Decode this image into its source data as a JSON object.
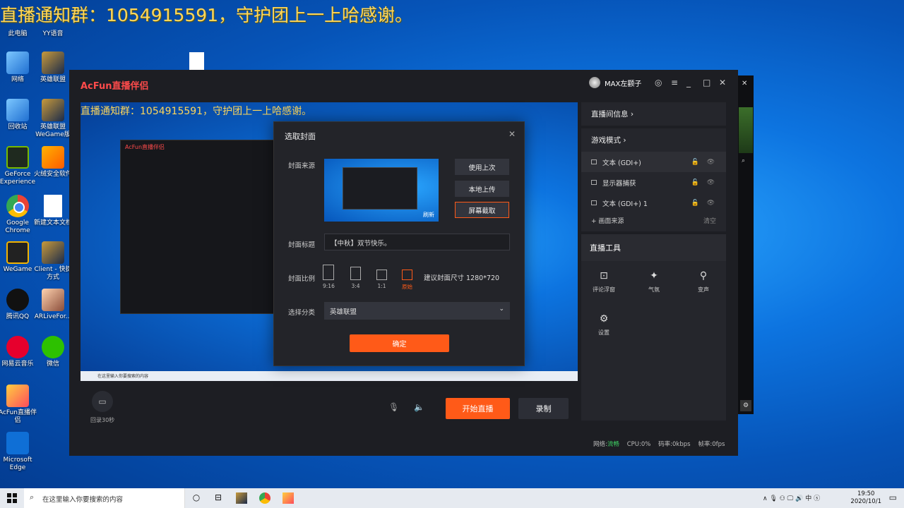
{
  "overlay_text": "直播通知群：1054915591，守护团上一上哈感谢。",
  "desktop_icons": [
    {
      "label": "此电脑",
      "icon": "computer-icon"
    },
    {
      "label": "YY语音",
      "icon": "yy-icon"
    },
    {
      "label": "网络",
      "icon": "network-icon"
    },
    {
      "label": "英雄联盟",
      "icon": "lol-icon"
    },
    {
      "label": "回收站",
      "icon": "recycle-bin-icon"
    },
    {
      "label": "英雄联盟WeGame版",
      "icon": "lol-wegame-icon"
    },
    {
      "label": "GeForce Experience",
      "icon": "geforce-icon"
    },
    {
      "label": "火绒安全软件",
      "icon": "huorong-icon"
    },
    {
      "label": "Google Chrome",
      "icon": "chrome-icon"
    },
    {
      "label": "新建文本文档",
      "icon": "text-file-icon"
    },
    {
      "label": "WeGame",
      "icon": "wegame-icon"
    },
    {
      "label": "Client - 快捷方式",
      "icon": "lol-client-icon"
    },
    {
      "label": "腾讯QQ",
      "icon": "qq-icon"
    },
    {
      "label": "ARLiveFor...",
      "icon": "arlive-icon"
    },
    {
      "label": "网易云音乐",
      "icon": "netease-music-icon"
    },
    {
      "label": "微信",
      "icon": "wechat-icon"
    },
    {
      "label": "AcFun直播伴侣",
      "icon": "acfun-icon"
    },
    {
      "label": "Microsoft Edge",
      "icon": "edge-icon"
    }
  ],
  "app": {
    "brand": "AcFun直播伴侣",
    "username": "MAX左颧子",
    "preview_overlay": "直播通知群：1054915591，守护团上一上哈感谢。",
    "preview_taskbar_search": "在这里输入你要搜索的内容",
    "record_label": "回录30秒",
    "start_label": "开始直播",
    "rec_label": "录制",
    "side": {
      "room_info": "直播间信息 ›",
      "game_mode": "游戏模式 ›",
      "sources": [
        "文本 (GDI+)",
        "显示器捕获",
        "文本 (GDI+) 1"
      ],
      "add_source": "+ 画面来源",
      "clear": "清空",
      "tools_title": "直播工具",
      "tools": [
        "评论浮窗",
        "气氛",
        "变声",
        "设置"
      ]
    },
    "status": {
      "net_label": "网络:",
      "net_val": "流畅",
      "cpu": "CPU:0%",
      "bitrate": "码率:0kbps",
      "fps": "帧率:0fps"
    }
  },
  "dialog": {
    "title": "选取封面",
    "cover_source_label": "封面来源",
    "refresh": "刷新",
    "btn_last": "使用上次",
    "btn_local": "本地上传",
    "btn_screen": "屏幕截取",
    "title_label": "封面标题",
    "title_value": "【中秋】双节快乐。",
    "ratio_label": "封面比例",
    "ratios": [
      "9:16",
      "3:4",
      "1:1",
      "原始"
    ],
    "hint": "建议封面尺寸 1280*720",
    "category_label": "选择分类",
    "category_value": "英雄联盟",
    "ok": "确定"
  },
  "taskbar": {
    "search_placeholder": "在这里输入你要搜索的内容",
    "time": "19:50",
    "date": "2020/10/1",
    "ime": "中"
  }
}
